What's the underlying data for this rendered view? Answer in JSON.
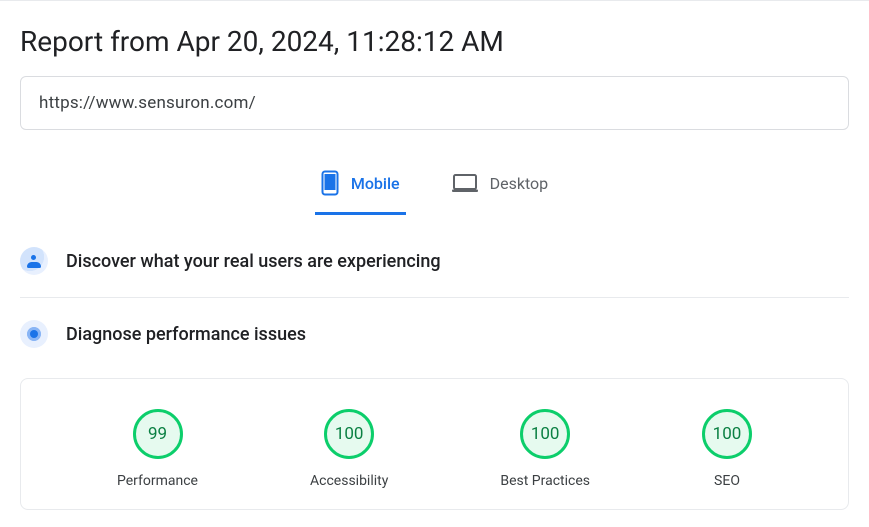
{
  "header": {
    "title": "Report from Apr 20, 2024, 11:28:12 AM"
  },
  "url_input": {
    "value": "https://www.sensuron.com/"
  },
  "tabs": {
    "mobile": "Mobile",
    "desktop": "Desktop",
    "active": "mobile"
  },
  "sections": {
    "real_users": "Discover what your real users are experiencing",
    "diagnose": "Diagnose performance issues"
  },
  "scores": [
    {
      "value": "99",
      "label": "Performance",
      "color": "#0cce6b"
    },
    {
      "value": "100",
      "label": "Accessibility",
      "color": "#0cce6b"
    },
    {
      "value": "100",
      "label": "Best Practices",
      "color": "#0cce6b"
    },
    {
      "value": "100",
      "label": "SEO",
      "color": "#0cce6b"
    }
  ]
}
